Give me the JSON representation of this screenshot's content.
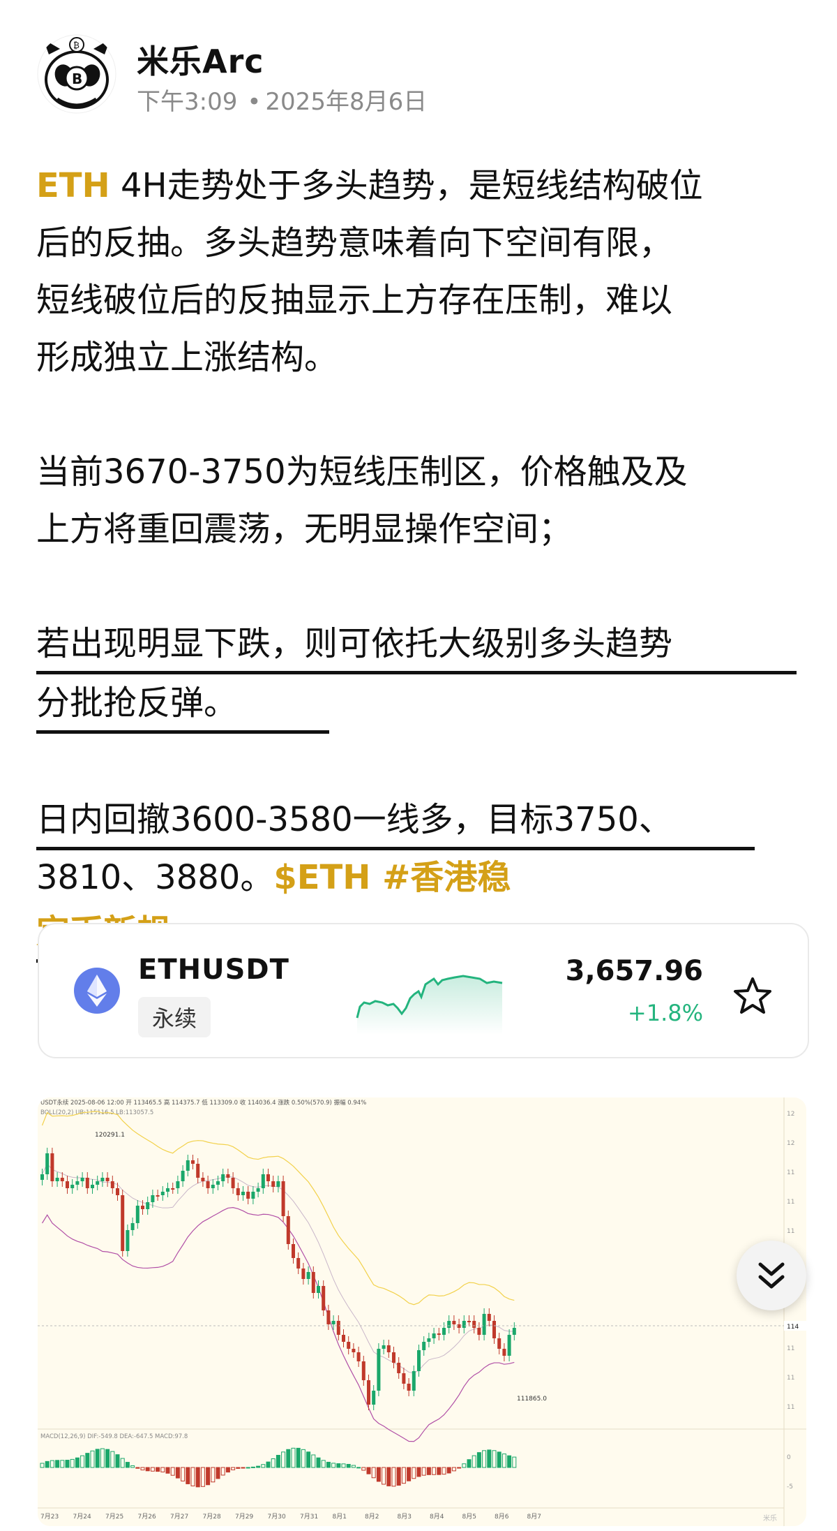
{
  "author": {
    "name": "米乐Arc",
    "time": "下午3:09",
    "date": "2025年8月6日"
  },
  "post": {
    "p1_tag": "ETH",
    "p1_line1": " 4H走势处于多头趋势，是短线结构破位",
    "p1_line2": "后的反抽。多头趋势意味着向下空间有限，",
    "p1_line3": "短线破位后的反抽显示上方存在压制，难以",
    "p1_line4": "形成独立上涨结构。",
    "p2_line1": "当前3670-3750为短线压制区，价格触及及",
    "p2_line2": "上方将重回震荡，无明显操作空间；",
    "p3_line1": "若出现明显下跌，则可依托大级别多头趋势",
    "p3_line2": "分批抢反弹。",
    "p4_line1": "日内回撤3600-3580一线多，目标3750、",
    "p4_line2": "3810、3880。",
    "p4_tags": "$ETH #香港稳定币新规"
  },
  "ticker": {
    "symbol": "ETHUSDT",
    "type": "永续",
    "price": "3,657.96",
    "change": "+1.8%",
    "icon": "ethereum-icon",
    "colors": {
      "up": "#24b47e",
      "eth": "#627eea",
      "gold": "#d4a017"
    }
  },
  "chart": {
    "header": "USDT永续 2025-08-06 12:00 开 113465.5 高 114375.7 低 113309.0 收 114036.4 涨跌 0.50%(570.9) 振幅 0.94%",
    "boll": "BOLL(20,2)  UB:115116.5  LB:113057.5",
    "macd": "MACD(12,26,9)  DIF:-549.8  DEA:-647.5  MACD:97.8",
    "high_label": "120291.1",
    "low_label": "111865.0",
    "x_labels": [
      "7月23",
      "7月24",
      "7月25",
      "7月26",
      "7月27",
      "7月28",
      "7月29",
      "7月30",
      "7月31",
      "8月1",
      "8月2",
      "8月3",
      "8月4",
      "8月5",
      "8月6",
      "8月7"
    ],
    "watermark": "米乐"
  }
}
